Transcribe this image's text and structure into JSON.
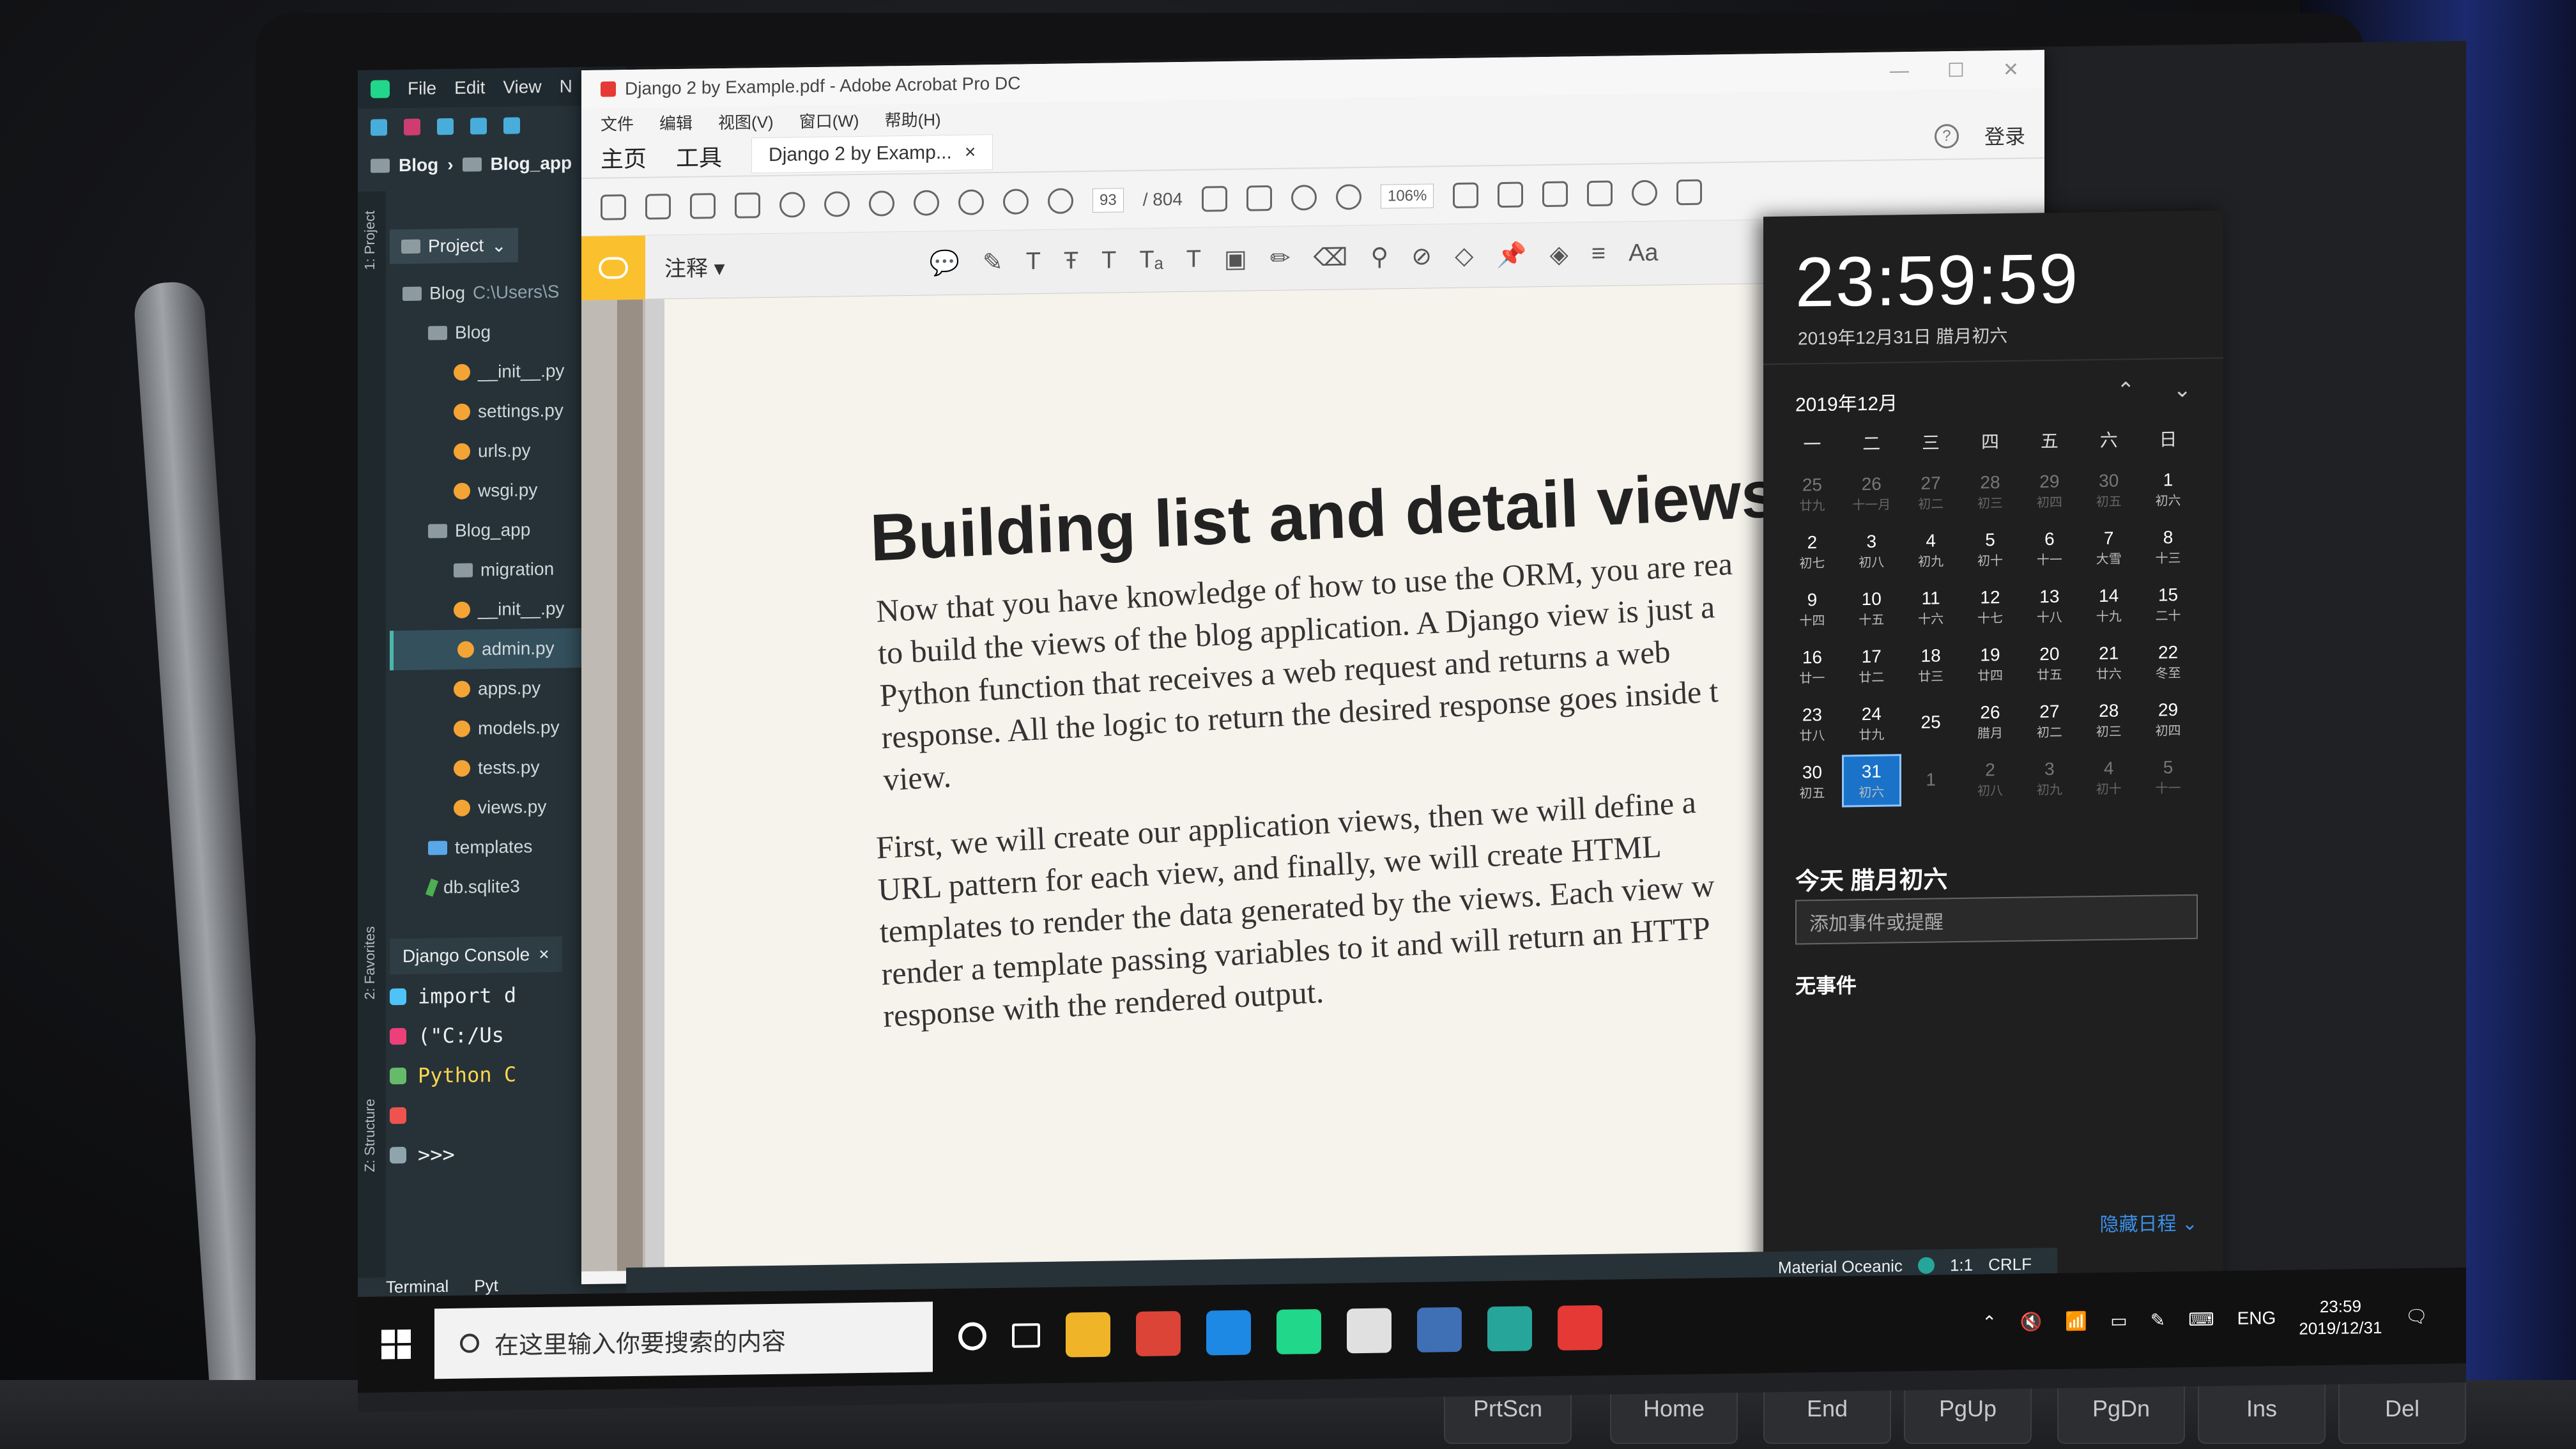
{
  "pycharm": {
    "menu": [
      "File",
      "Edit",
      "View",
      "N"
    ],
    "breadcrumb": [
      "Blog",
      "Blog_app"
    ],
    "project_label": "Project",
    "side_tabs": [
      "1: Project",
      "2: Favorites",
      "Z: Structure"
    ],
    "tree": [
      {
        "label": "Blog",
        "extra": "C:\\Users\\S",
        "type": "folder",
        "level": 0
      },
      {
        "label": "Blog",
        "type": "folder",
        "level": 1
      },
      {
        "label": "__init__.py",
        "type": "py",
        "level": 2
      },
      {
        "label": "settings.py",
        "type": "py",
        "level": 2
      },
      {
        "label": "urls.py",
        "type": "py",
        "level": 2
      },
      {
        "label": "wsgi.py",
        "type": "py",
        "level": 2
      },
      {
        "label": "Blog_app",
        "type": "folder",
        "level": 1
      },
      {
        "label": "migration",
        "type": "folder",
        "level": 2
      },
      {
        "label": "__init__.py",
        "type": "py",
        "level": 2
      },
      {
        "label": "admin.py",
        "type": "py",
        "level": 2,
        "selected": true
      },
      {
        "label": "apps.py",
        "type": "py",
        "level": 2
      },
      {
        "label": "models.py",
        "type": "py",
        "level": 2
      },
      {
        "label": "tests.py",
        "type": "py",
        "level": 2
      },
      {
        "label": "views.py",
        "type": "py",
        "level": 2
      },
      {
        "label": "templates",
        "type": "folder-blue",
        "level": 1
      },
      {
        "label": "db.sqlite3",
        "type": "db",
        "level": 1
      }
    ],
    "console_tab": "Django Console",
    "console_lines": [
      "import d",
      "(\"C:/Us",
      "Python C",
      "",
      ">>>"
    ],
    "bottom_tabs": [
      "Terminal",
      "Pyt"
    ]
  },
  "acrobat": {
    "title": "Django 2 by Example.pdf - Adobe Acrobat Pro DC",
    "menu": [
      "文件",
      "编辑",
      "视图(V)",
      "窗口(W)",
      "帮助(H)"
    ],
    "tabs": [
      "主页",
      "工具"
    ],
    "doc_tab": "Django 2 by Examp...",
    "login": "登录",
    "page_current": "93",
    "page_total": "/ 804",
    "zoom": "106%",
    "annot_label": "注释",
    "heading": "Building list and detail views",
    "para1": [
      "Now that you have knowledge of how to use the ORM, you are rea",
      "to build the views of the blog application. A Django view is just a",
      "Python function that receives a web request and returns a web",
      "response. All the logic to return the desired response goes inside t",
      "view."
    ],
    "para2": [
      "First, we will create our application views, then we will define a",
      "URL pattern for each view, and finally, we will create HTML",
      "templates to render the data generated by the views. Each view w",
      "render a template passing variables to it and will return an HTTP",
      "response with the rendered output."
    ]
  },
  "calendar": {
    "time": "23:59:59",
    "date": "2019年12月31日 腊月初六",
    "month": "2019年12月",
    "weekdays": [
      "一",
      "二",
      "三",
      "四",
      "五",
      "六",
      "日"
    ],
    "days": [
      {
        "d": "25",
        "l": "廿九",
        "dim": true
      },
      {
        "d": "26",
        "l": "十一月",
        "dim": true
      },
      {
        "d": "27",
        "l": "初二",
        "dim": true
      },
      {
        "d": "28",
        "l": "初三",
        "dim": true
      },
      {
        "d": "29",
        "l": "初四",
        "dim": true
      },
      {
        "d": "30",
        "l": "初五",
        "dim": true
      },
      {
        "d": "1",
        "l": "初六"
      },
      {
        "d": "2",
        "l": "初七"
      },
      {
        "d": "3",
        "l": "初八"
      },
      {
        "d": "4",
        "l": "初九"
      },
      {
        "d": "5",
        "l": "初十"
      },
      {
        "d": "6",
        "l": "十一"
      },
      {
        "d": "7",
        "l": "大雪"
      },
      {
        "d": "8",
        "l": "十三"
      },
      {
        "d": "9",
        "l": "十四"
      },
      {
        "d": "10",
        "l": "十五"
      },
      {
        "d": "11",
        "l": "十六"
      },
      {
        "d": "12",
        "l": "十七"
      },
      {
        "d": "13",
        "l": "十八"
      },
      {
        "d": "14",
        "l": "十九"
      },
      {
        "d": "15",
        "l": "二十"
      },
      {
        "d": "16",
        "l": "廿一"
      },
      {
        "d": "17",
        "l": "廿二"
      },
      {
        "d": "18",
        "l": "廿三"
      },
      {
        "d": "19",
        "l": "廿四"
      },
      {
        "d": "20",
        "l": "廿五"
      },
      {
        "d": "21",
        "l": "廿六"
      },
      {
        "d": "22",
        "l": "冬至"
      },
      {
        "d": "23",
        "l": "廿八"
      },
      {
        "d": "24",
        "l": "廿九"
      },
      {
        "d": "25",
        "l": ""
      },
      {
        "d": "26",
        "l": "腊月"
      },
      {
        "d": "27",
        "l": "初二"
      },
      {
        "d": "28",
        "l": "初三"
      },
      {
        "d": "29",
        "l": "初四"
      },
      {
        "d": "30",
        "l": "初五"
      },
      {
        "d": "31",
        "l": "初六",
        "today": true
      },
      {
        "d": "1",
        "l": "",
        "dim": true
      },
      {
        "d": "2",
        "l": "初八",
        "dim": true
      },
      {
        "d": "3",
        "l": "初九",
        "dim": true
      },
      {
        "d": "4",
        "l": "初十",
        "dim": true
      },
      {
        "d": "5",
        "l": "十一",
        "dim": true
      }
    ],
    "today_label": "今天 腊月初六",
    "event_placeholder": "添加事件或提醒",
    "no_events": "无事件",
    "hide_schedule": "隐藏日程"
  },
  "statusbar": {
    "theme": "Material Oceanic",
    "position": "1:1",
    "line_ending": "CRLF"
  },
  "taskbar": {
    "search_placeholder": "在这里输入你要搜索的内容",
    "lang": "ENG",
    "clock_time": "23:59",
    "clock_date": "2019/12/31",
    "apps": [
      {
        "name": "file-explorer-icon",
        "color": "#f0b429"
      },
      {
        "name": "chrome-icon",
        "color": "#db4437"
      },
      {
        "name": "app-blue-icon",
        "color": "#1e88e5"
      },
      {
        "name": "pycharm-icon",
        "color": "#21d789"
      },
      {
        "name": "media-icon",
        "color": "#e0e0e0"
      },
      {
        "name": "sql-icon",
        "color": "#3f6fb5"
      },
      {
        "name": "app-teal-icon",
        "color": "#26a69a"
      },
      {
        "name": "acrobat-icon",
        "color": "#e53935"
      }
    ]
  },
  "keyboard": [
    "PrtScn",
    "Home",
    "End",
    "PgUp",
    "PgDn",
    "Ins",
    "Del"
  ],
  "colors": {
    "accent": "#1a73c8",
    "pycharm_bg": "#263238",
    "acrobat_annot": "#fbc02d"
  }
}
